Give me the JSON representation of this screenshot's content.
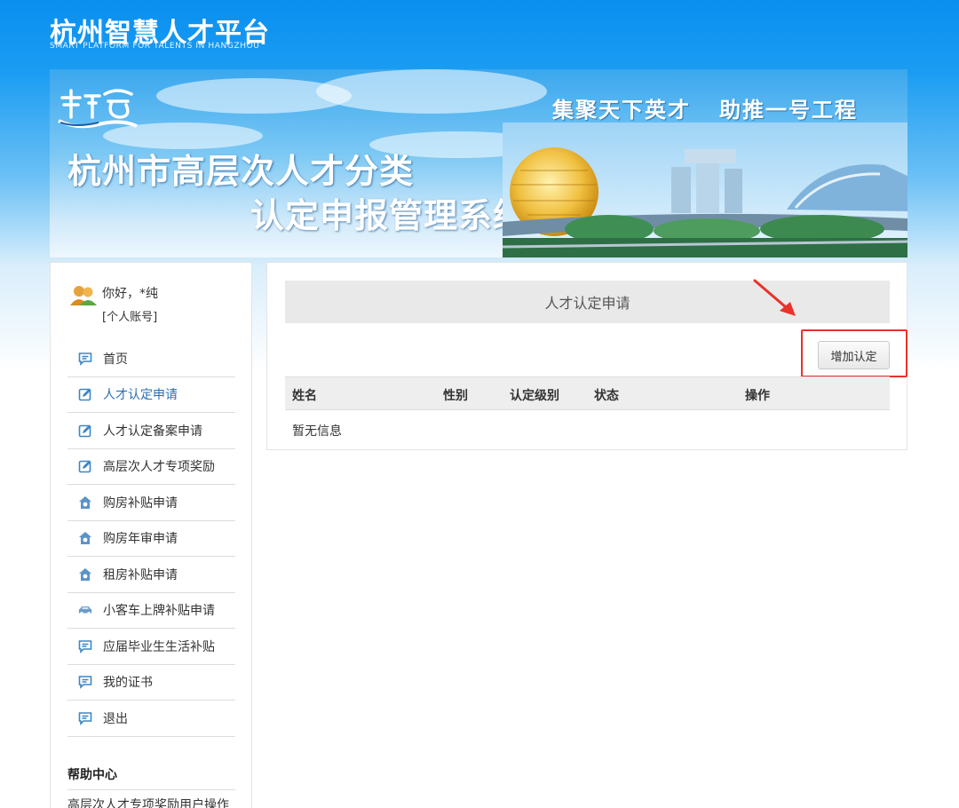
{
  "header": {
    "logo_cn": "杭州智慧人才平台",
    "logo_en": "SMART PLATFORM FOR TALENTS IN HANGZHOU"
  },
  "banner": {
    "title_line1": "杭州市高层次人才分类",
    "title_line2": "认定申报管理系统",
    "slogan1": "集聚天下英才",
    "slogan2": "助推一号工程"
  },
  "user": {
    "greeting": "你好，*纯",
    "account_type": "[个人账号]"
  },
  "menu": {
    "items": [
      {
        "label": "首页",
        "icon": "message-icon"
      },
      {
        "label": "人才认定申请",
        "icon": "edit-icon"
      },
      {
        "label": "人才认定备案申请",
        "icon": "edit-icon"
      },
      {
        "label": "高层次人才专项奖励",
        "icon": "edit-icon"
      },
      {
        "label": "购房补贴申请",
        "icon": "house-icon"
      },
      {
        "label": "购房年审申请",
        "icon": "house-icon"
      },
      {
        "label": "租房补贴申请",
        "icon": "house-icon"
      },
      {
        "label": "小客车上牌补贴申请",
        "icon": "car-icon"
      },
      {
        "label": "应届毕业生生活补贴",
        "icon": "message-icon"
      },
      {
        "label": "我的证书",
        "icon": "message-icon"
      },
      {
        "label": "退出",
        "icon": "message-icon"
      }
    ],
    "active_index": 1
  },
  "help": {
    "title": "帮助中心",
    "item": "高层次人才专项奖励用户操作"
  },
  "main": {
    "panel_title": "人才认定申请",
    "add_button": "增加认定",
    "table": {
      "headers": [
        "姓名",
        "性别",
        "认定级别",
        "状态",
        "操作"
      ],
      "empty_text": "暂无信息"
    }
  },
  "colors": {
    "header_blue": "#0a8ff0",
    "active_menu": "#2b6fb6",
    "icon_blue": "#3d86c6",
    "highlight_red": "#e8332a"
  }
}
